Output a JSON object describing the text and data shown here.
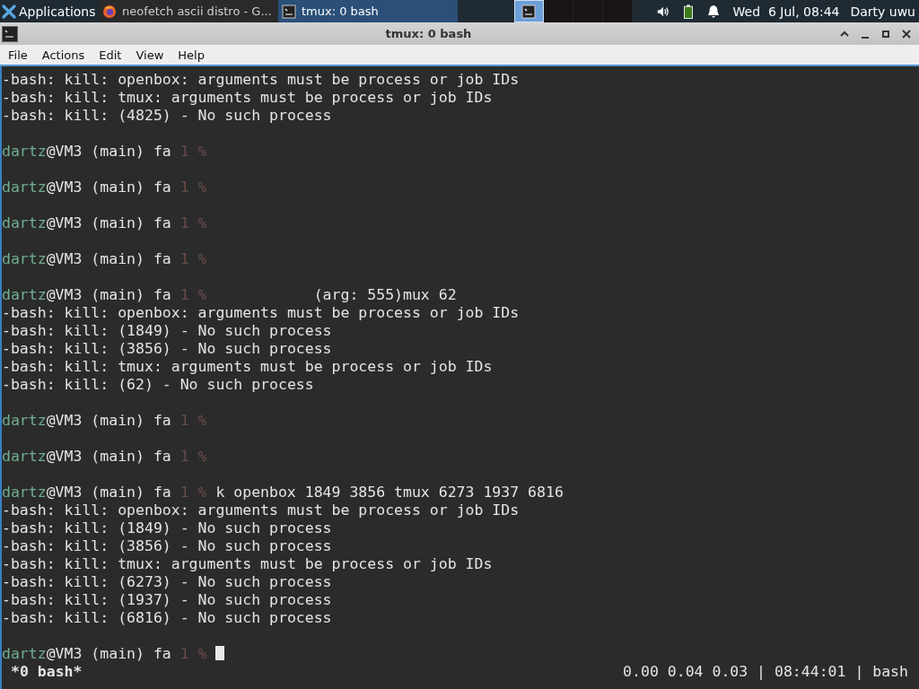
{
  "taskbar": {
    "apps_menu": "Applications",
    "tasks": [
      {
        "title": "neofetch ascii distro - G...",
        "kind": "browser",
        "selected": false
      },
      {
        "title": "tmux: 0 bash",
        "kind": "terminal",
        "selected": true
      }
    ],
    "workspaces": [
      {
        "selected": true
      },
      {
        "selected": false
      },
      {
        "selected": false
      },
      {
        "selected": false
      }
    ],
    "clock": "Wed  6 Jul, 08:44",
    "user": "Darty uwu"
  },
  "window": {
    "title": "tmux: 0 bash",
    "menu": [
      "File",
      "Actions",
      "Edit",
      "View",
      "Help"
    ]
  },
  "terminal": {
    "lines": [
      {
        "kind": "output",
        "text": "-bash: kill: openbox: arguments must be process or job IDs"
      },
      {
        "kind": "output",
        "text": "-bash: kill: tmux: arguments must be process or job IDs"
      },
      {
        "kind": "output",
        "text": "-bash: kill: (4825) - No such process"
      },
      {
        "kind": "blank"
      },
      {
        "kind": "prompt",
        "user": "dartz",
        "host": "@VM3 (main) fa",
        "status": "1",
        "sign": "%"
      },
      {
        "kind": "blank"
      },
      {
        "kind": "prompt",
        "user": "dartz",
        "host": "@VM3 (main) fa",
        "status": "1",
        "sign": "%"
      },
      {
        "kind": "blank"
      },
      {
        "kind": "prompt",
        "user": "dartz",
        "host": "@VM3 (main) fa",
        "status": "1",
        "sign": "%"
      },
      {
        "kind": "blank"
      },
      {
        "kind": "prompt",
        "user": "dartz",
        "host": "@VM3 (main) fa",
        "status": "1",
        "sign": "%"
      },
      {
        "kind": "blank"
      },
      {
        "kind": "prompt",
        "user": "dartz",
        "host": "@VM3 (main) fa",
        "status": "1",
        "sign": "%",
        "command": "           (arg: 555)mux 62"
      },
      {
        "kind": "output",
        "text": "-bash: kill: openbox: arguments must be process or job IDs"
      },
      {
        "kind": "output",
        "text": "-bash: kill: (1849) - No such process"
      },
      {
        "kind": "output",
        "text": "-bash: kill: (3856) - No such process"
      },
      {
        "kind": "output",
        "text": "-bash: kill: tmux: arguments must be process or job IDs"
      },
      {
        "kind": "output",
        "text": "-bash: kill: (62) - No such process"
      },
      {
        "kind": "blank"
      },
      {
        "kind": "prompt",
        "user": "dartz",
        "host": "@VM3 (main) fa",
        "status": "1",
        "sign": "%"
      },
      {
        "kind": "blank"
      },
      {
        "kind": "prompt",
        "user": "dartz",
        "host": "@VM3 (main) fa",
        "status": "1",
        "sign": "%"
      },
      {
        "kind": "blank"
      },
      {
        "kind": "prompt",
        "user": "dartz",
        "host": "@VM3 (main) fa",
        "status": "1",
        "sign": "%",
        "command": "k openbox 1849 3856 tmux 6273 1937 6816"
      },
      {
        "kind": "output",
        "text": "-bash: kill: openbox: arguments must be process or job IDs"
      },
      {
        "kind": "output",
        "text": "-bash: kill: (1849) - No such process"
      },
      {
        "kind": "output",
        "text": "-bash: kill: (3856) - No such process"
      },
      {
        "kind": "output",
        "text": "-bash: kill: tmux: arguments must be process or job IDs"
      },
      {
        "kind": "output",
        "text": "-bash: kill: (6273) - No such process"
      },
      {
        "kind": "output",
        "text": "-bash: kill: (1937) - No such process"
      },
      {
        "kind": "output",
        "text": "-bash: kill: (6816) - No such process"
      },
      {
        "kind": "blank"
      },
      {
        "kind": "prompt",
        "user": "dartz",
        "host": "@VM3 (main) fa",
        "status": "1",
        "sign": "%",
        "cursor": true
      }
    ]
  },
  "status_bar": {
    "window": "*0 bash*",
    "right": "0.00 0.04 0.03 | 08:44:01 | bash"
  }
}
